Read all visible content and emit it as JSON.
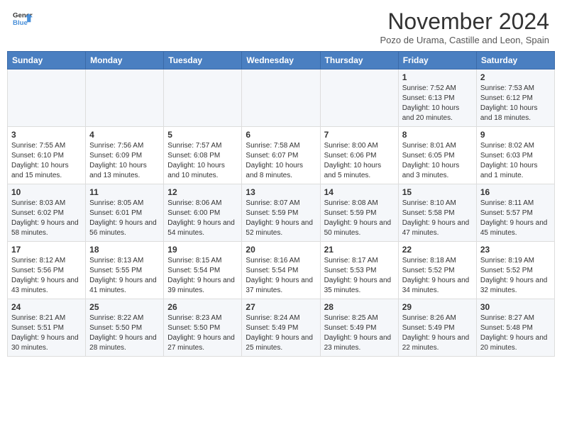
{
  "header": {
    "logo_line1": "General",
    "logo_line2": "Blue",
    "month": "November 2024",
    "location": "Pozo de Urama, Castille and Leon, Spain"
  },
  "days_of_week": [
    "Sunday",
    "Monday",
    "Tuesday",
    "Wednesday",
    "Thursday",
    "Friday",
    "Saturday"
  ],
  "weeks": [
    [
      {
        "day": "",
        "info": ""
      },
      {
        "day": "",
        "info": ""
      },
      {
        "day": "",
        "info": ""
      },
      {
        "day": "",
        "info": ""
      },
      {
        "day": "",
        "info": ""
      },
      {
        "day": "1",
        "info": "Sunrise: 7:52 AM\nSunset: 6:13 PM\nDaylight: 10 hours and 20 minutes."
      },
      {
        "day": "2",
        "info": "Sunrise: 7:53 AM\nSunset: 6:12 PM\nDaylight: 10 hours and 18 minutes."
      }
    ],
    [
      {
        "day": "3",
        "info": "Sunrise: 7:55 AM\nSunset: 6:10 PM\nDaylight: 10 hours and 15 minutes."
      },
      {
        "day": "4",
        "info": "Sunrise: 7:56 AM\nSunset: 6:09 PM\nDaylight: 10 hours and 13 minutes."
      },
      {
        "day": "5",
        "info": "Sunrise: 7:57 AM\nSunset: 6:08 PM\nDaylight: 10 hours and 10 minutes."
      },
      {
        "day": "6",
        "info": "Sunrise: 7:58 AM\nSunset: 6:07 PM\nDaylight: 10 hours and 8 minutes."
      },
      {
        "day": "7",
        "info": "Sunrise: 8:00 AM\nSunset: 6:06 PM\nDaylight: 10 hours and 5 minutes."
      },
      {
        "day": "8",
        "info": "Sunrise: 8:01 AM\nSunset: 6:05 PM\nDaylight: 10 hours and 3 minutes."
      },
      {
        "day": "9",
        "info": "Sunrise: 8:02 AM\nSunset: 6:03 PM\nDaylight: 10 hours and 1 minute."
      }
    ],
    [
      {
        "day": "10",
        "info": "Sunrise: 8:03 AM\nSunset: 6:02 PM\nDaylight: 9 hours and 58 minutes."
      },
      {
        "day": "11",
        "info": "Sunrise: 8:05 AM\nSunset: 6:01 PM\nDaylight: 9 hours and 56 minutes."
      },
      {
        "day": "12",
        "info": "Sunrise: 8:06 AM\nSunset: 6:00 PM\nDaylight: 9 hours and 54 minutes."
      },
      {
        "day": "13",
        "info": "Sunrise: 8:07 AM\nSunset: 5:59 PM\nDaylight: 9 hours and 52 minutes."
      },
      {
        "day": "14",
        "info": "Sunrise: 8:08 AM\nSunset: 5:59 PM\nDaylight: 9 hours and 50 minutes."
      },
      {
        "day": "15",
        "info": "Sunrise: 8:10 AM\nSunset: 5:58 PM\nDaylight: 9 hours and 47 minutes."
      },
      {
        "day": "16",
        "info": "Sunrise: 8:11 AM\nSunset: 5:57 PM\nDaylight: 9 hours and 45 minutes."
      }
    ],
    [
      {
        "day": "17",
        "info": "Sunrise: 8:12 AM\nSunset: 5:56 PM\nDaylight: 9 hours and 43 minutes."
      },
      {
        "day": "18",
        "info": "Sunrise: 8:13 AM\nSunset: 5:55 PM\nDaylight: 9 hours and 41 minutes."
      },
      {
        "day": "19",
        "info": "Sunrise: 8:15 AM\nSunset: 5:54 PM\nDaylight: 9 hours and 39 minutes."
      },
      {
        "day": "20",
        "info": "Sunrise: 8:16 AM\nSunset: 5:54 PM\nDaylight: 9 hours and 37 minutes."
      },
      {
        "day": "21",
        "info": "Sunrise: 8:17 AM\nSunset: 5:53 PM\nDaylight: 9 hours and 35 minutes."
      },
      {
        "day": "22",
        "info": "Sunrise: 8:18 AM\nSunset: 5:52 PM\nDaylight: 9 hours and 34 minutes."
      },
      {
        "day": "23",
        "info": "Sunrise: 8:19 AM\nSunset: 5:52 PM\nDaylight: 9 hours and 32 minutes."
      }
    ],
    [
      {
        "day": "24",
        "info": "Sunrise: 8:21 AM\nSunset: 5:51 PM\nDaylight: 9 hours and 30 minutes."
      },
      {
        "day": "25",
        "info": "Sunrise: 8:22 AM\nSunset: 5:50 PM\nDaylight: 9 hours and 28 minutes."
      },
      {
        "day": "26",
        "info": "Sunrise: 8:23 AM\nSunset: 5:50 PM\nDaylight: 9 hours and 27 minutes."
      },
      {
        "day": "27",
        "info": "Sunrise: 8:24 AM\nSunset: 5:49 PM\nDaylight: 9 hours and 25 minutes."
      },
      {
        "day": "28",
        "info": "Sunrise: 8:25 AM\nSunset: 5:49 PM\nDaylight: 9 hours and 23 minutes."
      },
      {
        "day": "29",
        "info": "Sunrise: 8:26 AM\nSunset: 5:49 PM\nDaylight: 9 hours and 22 minutes."
      },
      {
        "day": "30",
        "info": "Sunrise: 8:27 AM\nSunset: 5:48 PM\nDaylight: 9 hours and 20 minutes."
      }
    ]
  ]
}
